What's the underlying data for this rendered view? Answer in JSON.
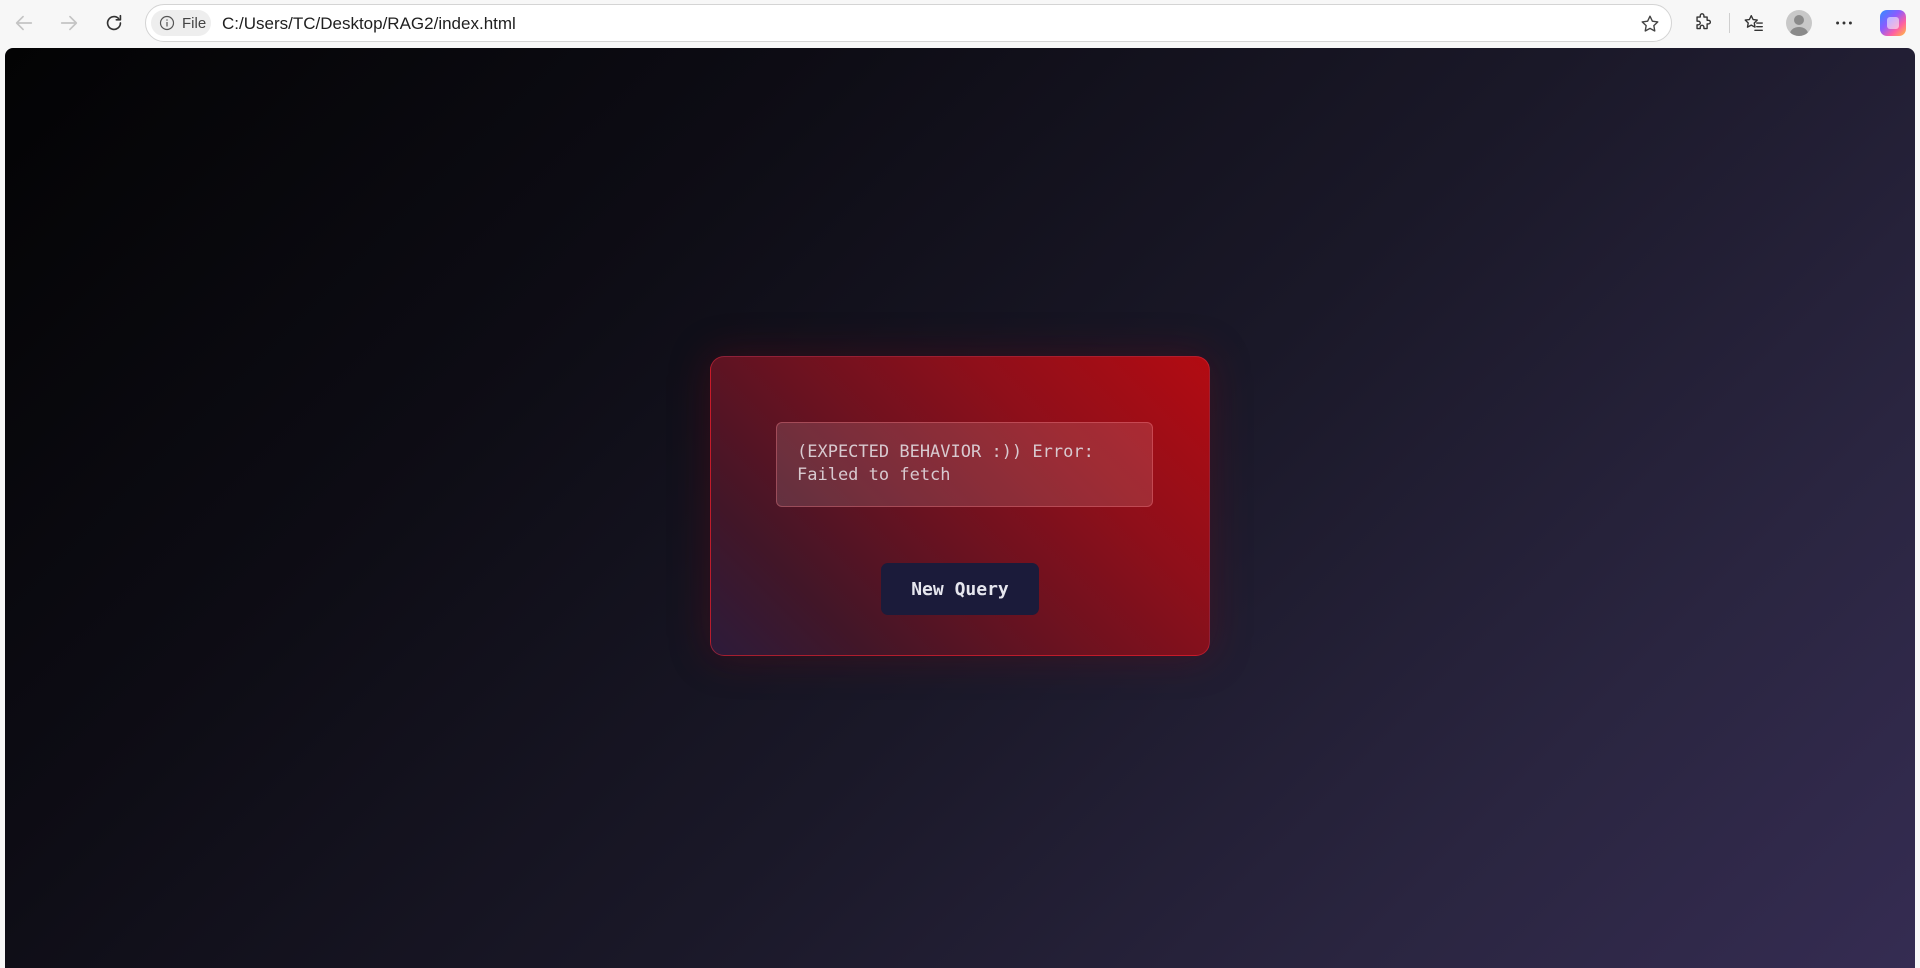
{
  "browser": {
    "site_chip_label": "File",
    "url": "C:/Users/TC/Desktop/RAG2/index.html",
    "icons": {
      "back": "back-arrow-icon",
      "forward": "forward-arrow-icon",
      "reload": "reload-icon",
      "info": "info-icon",
      "favorite": "star-icon",
      "extensions": "extensions-icon",
      "favorites": "favorites-icon",
      "profile": "profile-avatar-icon",
      "more": "more-options-icon",
      "copilot": "copilot-icon"
    }
  },
  "page": {
    "error_message": "(EXPECTED BEHAVIOR :)) Error:\nFailed to fetch",
    "new_query_label": "New Query",
    "colors": {
      "card_accent": "#b30b12",
      "button_bg": "#1b1b3a",
      "background_dark": "#030304",
      "background_light": "#352c52"
    }
  }
}
